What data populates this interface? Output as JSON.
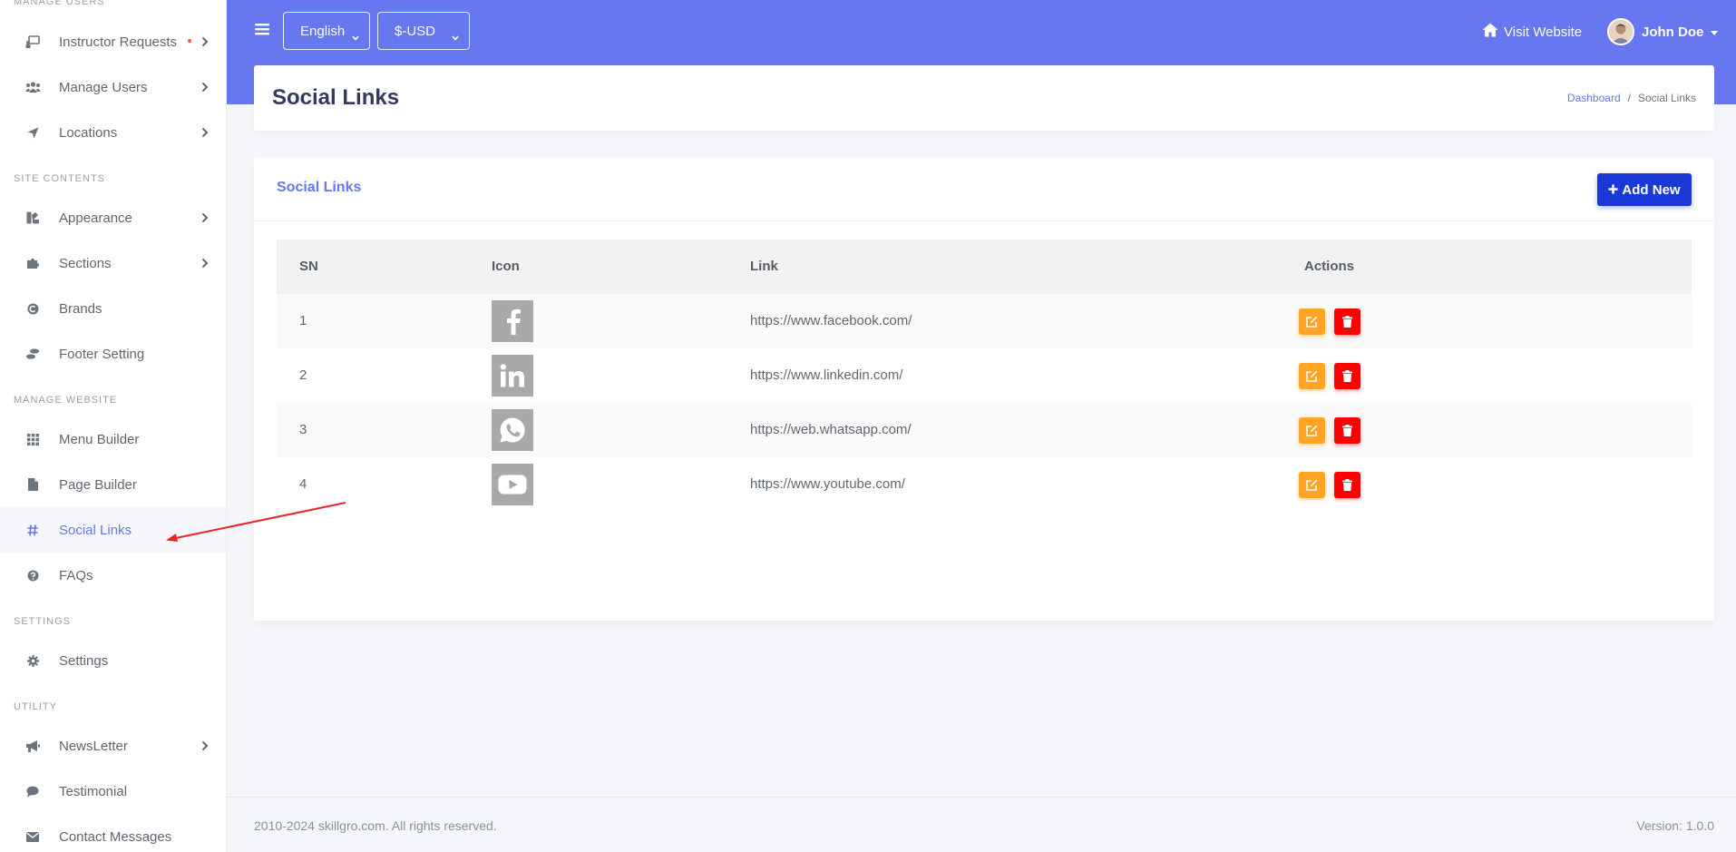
{
  "sidebar": {
    "sections": {
      "manage_users": "MANAGE USERS",
      "site_contents": "SITE CONTENTS",
      "manage_website": "MANAGE WEBSITE",
      "settings": "SETTINGS",
      "utility": "UTILITY"
    },
    "items": {
      "instructor_requests": "Instructor Requests",
      "manage_users": "Manage Users",
      "locations": "Locations",
      "appearance": "Appearance",
      "sections": "Sections",
      "brands": "Brands",
      "footer_setting": "Footer Setting",
      "menu_builder": "Menu Builder",
      "page_builder": "Page Builder",
      "social_links": "Social Links",
      "faqs": "FAQs",
      "settings": "Settings",
      "newsletter": "NewsLetter",
      "testimonial": "Testimonial",
      "contact_messages": "Contact Messages"
    },
    "active_item": "social_links"
  },
  "topbar": {
    "language": "English",
    "currency": "$-USD",
    "visit_website": "Visit Website",
    "user_name": "John Doe"
  },
  "page": {
    "title": "Social Links",
    "breadcrumb": {
      "home": "Dashboard",
      "separator": "/",
      "current": "Social Links"
    }
  },
  "card": {
    "title": "Social Links",
    "add_button": "Add New"
  },
  "table": {
    "headers": {
      "sn": "SN",
      "icon": "Icon",
      "link": "Link",
      "actions": "Actions"
    },
    "rows": [
      {
        "sn": "1",
        "icon": "facebook-icon",
        "link": "https://www.facebook.com/"
      },
      {
        "sn": "2",
        "icon": "linkedin-icon",
        "link": "https://www.linkedin.com/"
      },
      {
        "sn": "3",
        "icon": "whatsapp-icon",
        "link": "https://web.whatsapp.com/"
      },
      {
        "sn": "4",
        "icon": "youtube-icon",
        "link": "https://www.youtube.com/"
      }
    ]
  },
  "footer": {
    "copyright": "2010-2024 skillgro.com. All rights reserved.",
    "version": "Version: 1.0.0"
  },
  "colors": {
    "primary": "#6777ef",
    "add_button": "#1b38d8",
    "edit": "#ffa426",
    "delete": "#fc0000",
    "annotation_arrow": "#e8262a"
  }
}
